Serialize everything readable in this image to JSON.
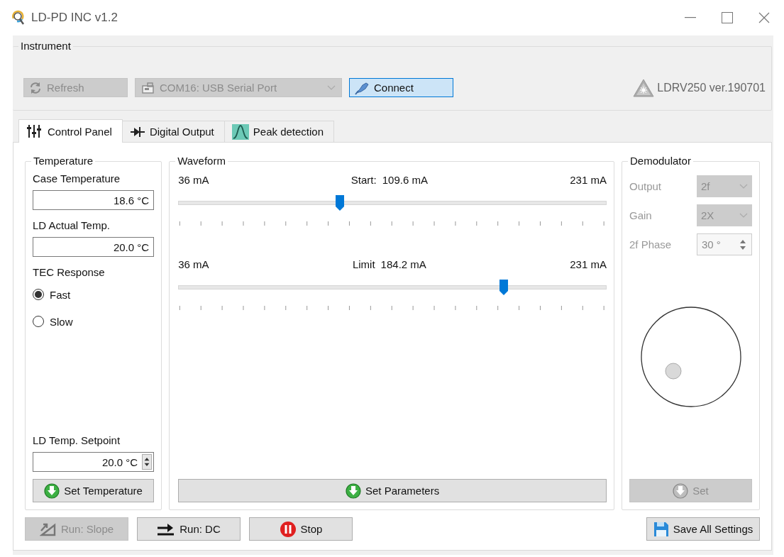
{
  "window": {
    "title": "LD-PD INC v1.2"
  },
  "instrument": {
    "title": "Instrument",
    "refresh": {
      "label": "Refresh",
      "disabled": true
    },
    "port": {
      "value": "COM16: USB Serial Port",
      "disabled": true
    },
    "connect": {
      "label": "Connect",
      "selected": true
    },
    "device": "LDRV250 ver.190701"
  },
  "tabs": [
    {
      "label": "Control Panel",
      "selected": true
    },
    {
      "label": "Digital Output",
      "selected": false
    },
    {
      "label": "Peak detection",
      "selected": false
    }
  ],
  "temperature": {
    "title": "Temperature",
    "case_label": "Case Temperature",
    "case_value": "18.6 °C",
    "actual_label": "LD Actual Temp.",
    "actual_value": "20.0 °C",
    "tec_label": "TEC Response",
    "tec_options": [
      {
        "label": "Fast",
        "selected": true
      },
      {
        "label": "Slow",
        "selected": false
      }
    ],
    "setpoint_label": "LD Temp. Setpoint",
    "setpoint_value": "20.0 °C",
    "set_button": "Set Temperature"
  },
  "waveform": {
    "title": "Waveform",
    "sliders": [
      {
        "min": "36 mA",
        "caption": "Start:",
        "reading": "109.6 mA",
        "max": "231 mA",
        "level": 0.377
      },
      {
        "min": "36 mA",
        "caption": "Limit",
        "reading": "184.2 mA",
        "max": "231 mA",
        "level": 0.76
      }
    ],
    "set_button": "Set Parameters"
  },
  "demodulator": {
    "title": "Demodulator",
    "fields": [
      {
        "label": "Output",
        "value": "2f",
        "kind": "dropdown",
        "disabled": true
      },
      {
        "label": "Gain",
        "value": "2X",
        "kind": "dropdown",
        "disabled": true
      },
      {
        "label": "2f Phase",
        "value": "30 °",
        "kind": "spinner",
        "disabled": true
      }
    ],
    "set_button": {
      "label": "Set",
      "disabled": true
    }
  },
  "actions": [
    {
      "label": "Run: Slope",
      "disabled": true
    },
    {
      "label": "Run: DC",
      "disabled": false
    },
    {
      "label": "Stop",
      "disabled": false
    }
  ],
  "save_button": "Save All Settings"
}
